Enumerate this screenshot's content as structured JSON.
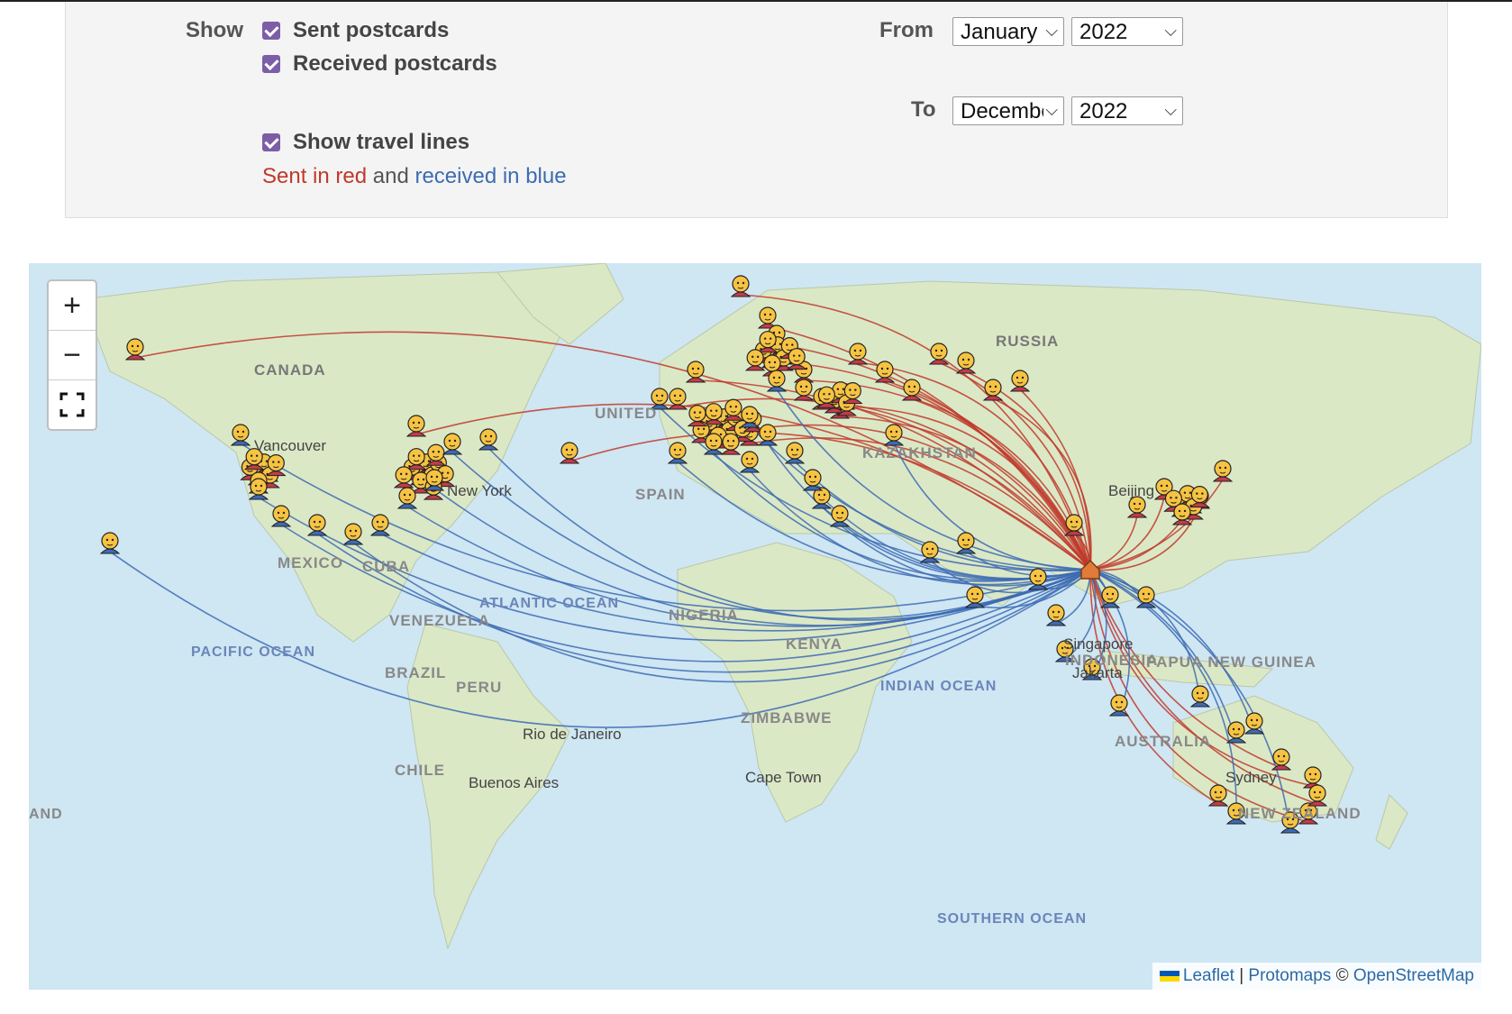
{
  "filters": {
    "show_label": "Show",
    "sent_label": "Sent postcards",
    "received_label": "Received postcards",
    "travel_label": "Show travel lines",
    "legend": {
      "sent": "Sent in red",
      "and": "and",
      "received": "received in blue"
    },
    "from_label": "From",
    "from_month": "January",
    "from_year": "2022",
    "to_label": "To",
    "to_month": "December",
    "to_year": "2022"
  },
  "colors": {
    "sent_line": "#c0392b",
    "received_line": "#3d6bb3",
    "checkbox": "#7b5ea7",
    "water": "#cfe6f3",
    "land": "#dbe8c6"
  },
  "map": {
    "zoom_in": "+",
    "zoom_out": "−",
    "fullscreen_icon": "fullscreen-icon",
    "attribution": {
      "leaflet": "Leaflet",
      "sep": "|",
      "protomaps": "Protomaps",
      "copyright": "©",
      "osm": "OpenStreetMap"
    },
    "labels": [
      {
        "text": "CANADA",
        "kind": "country"
      },
      {
        "text": "RUSSIA",
        "kind": "country"
      },
      {
        "text": "KAZAKHSTAN",
        "kind": "country"
      },
      {
        "text": "SPAIN",
        "kind": "country"
      },
      {
        "text": "UNITED",
        "kind": "country"
      },
      {
        "text": "MEXICO",
        "kind": "country"
      },
      {
        "text": "CUBA",
        "kind": "country"
      },
      {
        "text": "VENEZUELA",
        "kind": "country"
      },
      {
        "text": "BRAZIL",
        "kind": "country"
      },
      {
        "text": "PERU",
        "kind": "country"
      },
      {
        "text": "CHILE",
        "kind": "country"
      },
      {
        "text": "NIGERIA",
        "kind": "country"
      },
      {
        "text": "KENYA",
        "kind": "country"
      },
      {
        "text": "ZIMBABWE",
        "kind": "country"
      },
      {
        "text": "INDONESIA",
        "kind": "country"
      },
      {
        "text": "PAPUA NEW GUINEA",
        "kind": "country"
      },
      {
        "text": "AUSTRALIA",
        "kind": "country"
      },
      {
        "text": "NEW ZEALAND",
        "kind": "country"
      },
      {
        "text": "PACIFIC OCEAN",
        "kind": "ocean"
      },
      {
        "text": "ATLANTIC OCEAN",
        "kind": "ocean"
      },
      {
        "text": "INDIAN OCEAN",
        "kind": "ocean"
      },
      {
        "text": "SOUTHERN OCEAN",
        "kind": "ocean"
      },
      {
        "text": "AND",
        "kind": "country"
      },
      {
        "text": "New York",
        "kind": "city"
      },
      {
        "text": "Vancouver",
        "kind": "city"
      },
      {
        "text": "Rio de Janeiro",
        "kind": "city"
      },
      {
        "text": "Buenos Aires",
        "kind": "city"
      },
      {
        "text": "Cape Town",
        "kind": "city"
      },
      {
        "text": "Singapore",
        "kind": "city"
      },
      {
        "text": "Jakarta",
        "kind": "city"
      },
      {
        "text": "Sydney",
        "kind": "city"
      },
      {
        "text": "Beijing",
        "kind": "city"
      }
    ]
  }
}
